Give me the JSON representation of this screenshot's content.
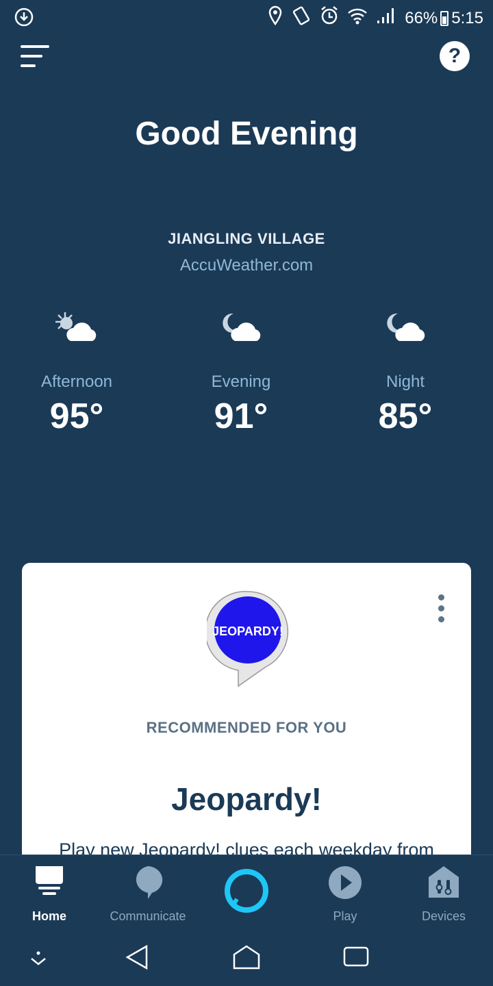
{
  "status_bar": {
    "battery": "66%",
    "time": "5:15"
  },
  "greeting": "Good Evening",
  "weather": {
    "location": "JIANGLING VILLAGE",
    "source": "AccuWeather.com",
    "periods": [
      {
        "label": "Afternoon",
        "temp": "95°",
        "icon": "partly-cloudy-day-icon"
      },
      {
        "label": "Evening",
        "temp": "91°",
        "icon": "partly-cloudy-night-icon"
      },
      {
        "label": "Night",
        "temp": "85°",
        "icon": "partly-cloudy-night-icon"
      }
    ]
  },
  "card": {
    "skill_logo_text": "JEOPARDY!",
    "section": "RECOMMENDED FOR YOU",
    "title": "Jeopardy!",
    "description": "Play new Jeopardy! clues each weekday from"
  },
  "bottom_nav": {
    "items": [
      {
        "label": "Home",
        "icon": "home-icon"
      },
      {
        "label": "Communicate",
        "icon": "chat-bubble-icon"
      },
      {
        "label": "",
        "icon": "alexa-ring-icon"
      },
      {
        "label": "Play",
        "icon": "play-icon"
      },
      {
        "label": "Devices",
        "icon": "devices-icon"
      }
    ]
  },
  "colors": {
    "background": "#1b3a56",
    "accent_text": "#8fb8d8",
    "alexa": "#1ec7f5",
    "card": "#ffffff"
  }
}
